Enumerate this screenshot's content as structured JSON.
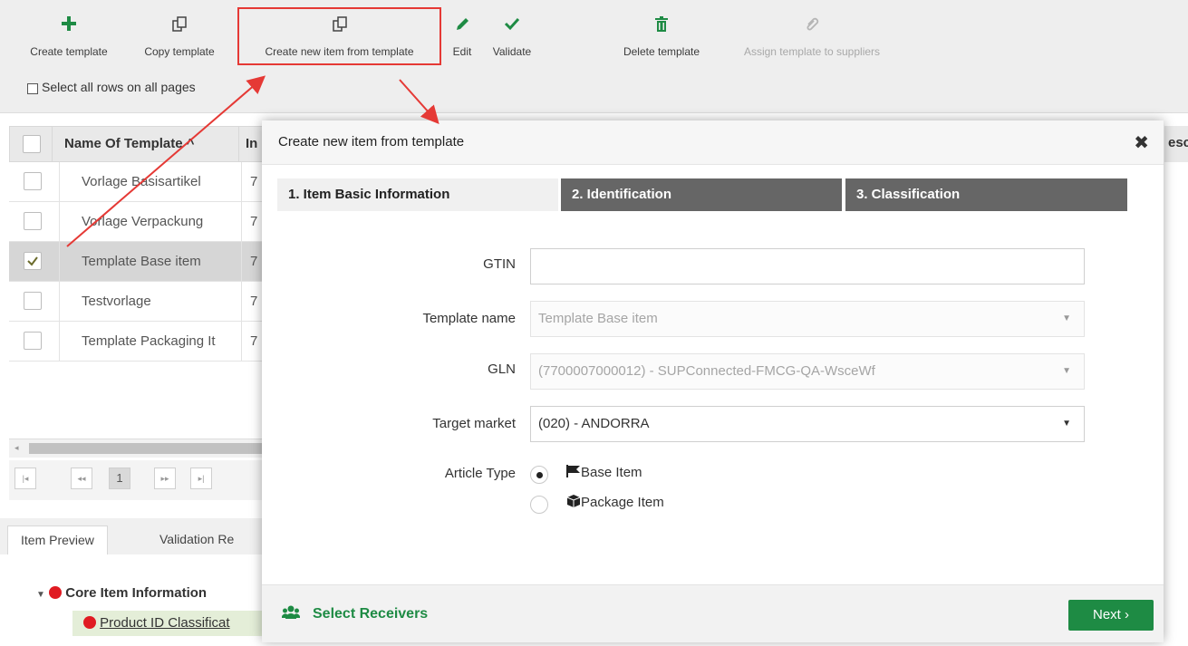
{
  "toolbar": {
    "items": [
      {
        "label": "Create template",
        "icon": "plus-icon",
        "enabled": true
      },
      {
        "label": "Copy template",
        "icon": "copy-icon",
        "enabled": true
      },
      {
        "label": "Create new item from template",
        "icon": "copy-icon",
        "enabled": true
      },
      {
        "label": "Edit",
        "icon": "pencil-icon",
        "enabled": true
      },
      {
        "label": "Validate",
        "icon": "check-icon",
        "enabled": true
      },
      {
        "label": "Delete template",
        "icon": "trash-icon",
        "enabled": true
      },
      {
        "label": "Assign template to suppliers",
        "icon": "paperclip-icon",
        "enabled": false
      }
    ],
    "select_all_label": "Select all rows on all pages"
  },
  "table": {
    "headers": [
      "Name Of Template ^",
      "In",
      "esc"
    ],
    "rows": [
      {
        "name": "Vorlage Basisartikel",
        "code": "7",
        "selected": false
      },
      {
        "name": "Vorlage Verpackung",
        "code": "7",
        "selected": false
      },
      {
        "name": "Template Base item",
        "code": "7",
        "selected": true
      },
      {
        "name": "Testvorlage",
        "code": "7",
        "selected": false
      },
      {
        "name": "Template Packaging It",
        "code": "7",
        "selected": false
      }
    ],
    "pager": {
      "first": "|◂",
      "prev": "◂◂",
      "page": "1",
      "next": "▸▸",
      "last": "▸|"
    }
  },
  "bottom_panel": {
    "tabs": [
      "Item Preview",
      "Validation Re"
    ],
    "tree": {
      "root": "Core Item Information",
      "child": "Product ID Classificat"
    }
  },
  "modal": {
    "title": "Create new item from template",
    "close_symbol": "✖",
    "steps": [
      "1. Item Basic Information",
      "2. Identification",
      "3. Classification"
    ],
    "fields": {
      "gtin": {
        "label": "GTIN",
        "value": ""
      },
      "template_name": {
        "label": "Template name",
        "value": "Template Base item"
      },
      "gln": {
        "label": "GLN",
        "value": "(7700007000012) - SUPConnected-FMCG-QA-WsceWf"
      },
      "target_market": {
        "label": "Target market",
        "value": "(020) - ANDORRA"
      },
      "article_type": {
        "label": "Article Type",
        "options": [
          {
            "label": "Base Item",
            "icon": "flag-icon",
            "checked": true
          },
          {
            "label": "Package Item",
            "icon": "box-icon",
            "checked": false
          }
        ]
      }
    },
    "footer": {
      "select_receivers": "Select Receivers",
      "next": "Next  ›"
    }
  },
  "colors": {
    "accent": "#1e8b44",
    "annotation": "#e53935",
    "error_dot": "#e01b22"
  }
}
